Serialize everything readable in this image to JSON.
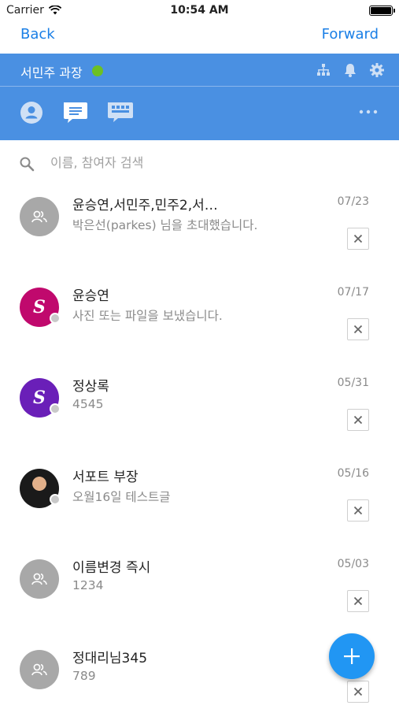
{
  "status_bar": {
    "carrier": "Carrier",
    "time": "10:54 AM"
  },
  "nav": {
    "back_label": "Back",
    "forward_label": "Forward"
  },
  "header": {
    "user_name": "서민주 과장",
    "online_color": "#6cc024",
    "accent_color": "#4a90e2",
    "top_icons": [
      "org-chart-icon",
      "bell-icon",
      "gear-icon"
    ],
    "tabs": [
      "profile-tab-icon",
      "chat-tab-icon",
      "message-tab-icon"
    ],
    "more_icon": "more-dots-icon"
  },
  "search": {
    "placeholder": "이름, 참여자 검색"
  },
  "conversations": [
    {
      "title": "윤승연,서민주,민주2,서…",
      "subtitle": "박은선(parkes) 님을 초대했습니다.",
      "date": "07/23",
      "avatar": "group",
      "avatar_letter": ""
    },
    {
      "title": "윤승연",
      "subtitle": "사진 또는 파일을 보냈습니다.",
      "date": "07/17",
      "avatar": "letter",
      "avatar_letter": "S"
    },
    {
      "title": "정상록",
      "subtitle": "4545",
      "date": "05/31",
      "avatar": "letter",
      "avatar_letter": "S"
    },
    {
      "title": "서포트 부장",
      "subtitle": "오월16일 테스트글",
      "date": "05/16",
      "avatar": "photo",
      "avatar_letter": ""
    },
    {
      "title": "이름변경 즉시",
      "subtitle": "1234",
      "date": "05/03",
      "avatar": "group",
      "avatar_letter": ""
    },
    {
      "title": "정대리님345",
      "subtitle": "789",
      "date": "",
      "avatar": "group",
      "avatar_letter": ""
    }
  ],
  "fab": {
    "icon": "plus-icon",
    "color": "#2196f3"
  }
}
